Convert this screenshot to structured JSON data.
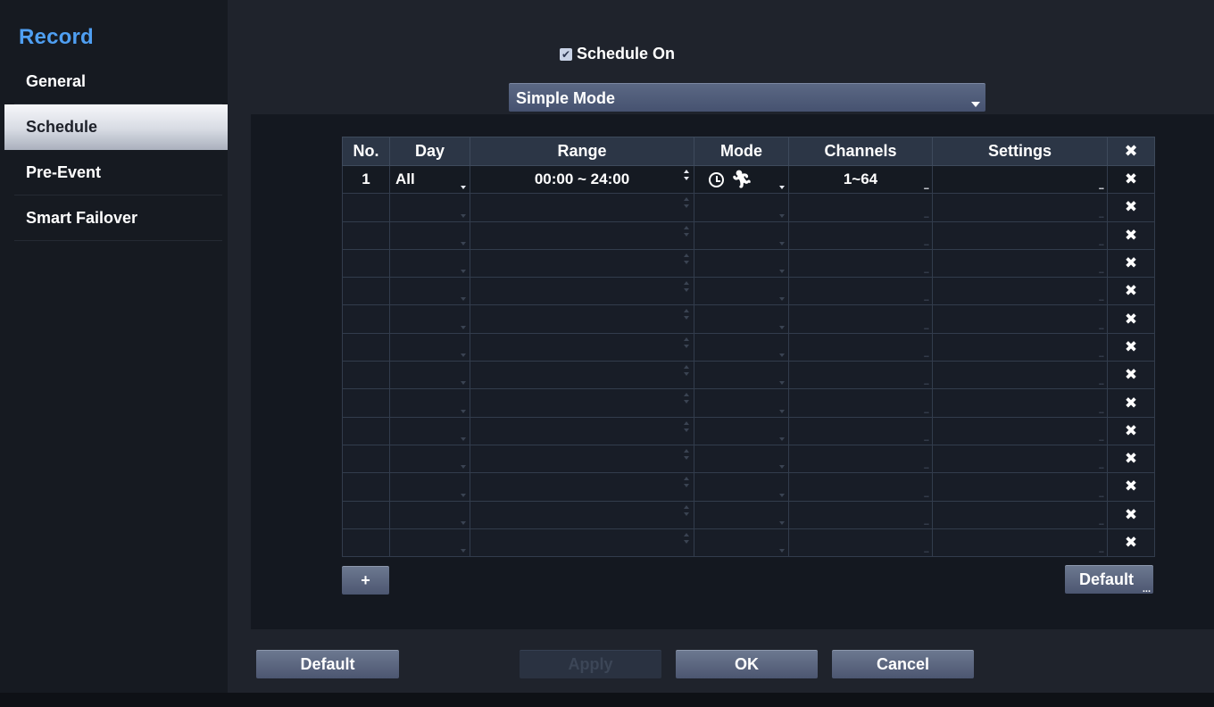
{
  "sidebar": {
    "title": "Record",
    "items": [
      {
        "label": "General",
        "active": false
      },
      {
        "label": "Schedule",
        "active": true
      },
      {
        "label": "Pre-Event",
        "active": false
      },
      {
        "label": "Smart Failover",
        "active": false
      }
    ]
  },
  "schedule": {
    "checkbox_label": "Schedule On",
    "checkbox_checked": true,
    "mode_select_value": "Simple Mode"
  },
  "table": {
    "headers": {
      "no": "No.",
      "day": "Day",
      "range": "Range",
      "mode": "Mode",
      "channels": "Channels",
      "settings": "Settings",
      "delete": "✖"
    },
    "rows": [
      {
        "no": "1",
        "day": "All",
        "range": "00:00 ~ 24:00",
        "mode_icons": [
          "clock-icon",
          "motion-icon"
        ],
        "channels": "1~64",
        "settings": "",
        "delete": "✖"
      }
    ],
    "empty_row_count": 13,
    "delete_glyph": "✖"
  },
  "buttons": {
    "add": "+",
    "table_default": "Default",
    "footer_default": "Default",
    "apply": "Apply",
    "ok": "OK",
    "cancel": "Cancel"
  },
  "colors": {
    "accent": "#4f9ff2",
    "button": "#5a6580",
    "background": "#1f232c"
  }
}
